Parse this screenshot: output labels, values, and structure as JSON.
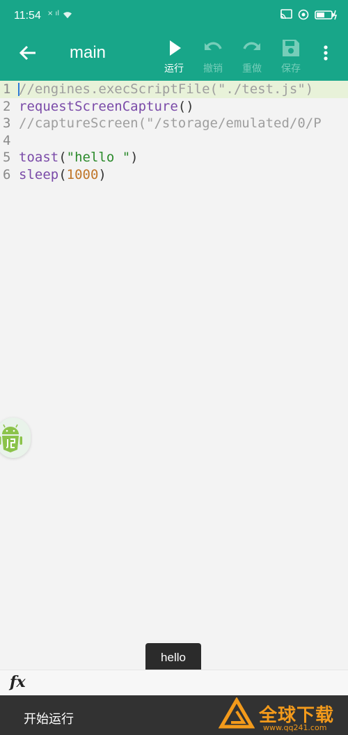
{
  "status_bar": {
    "time": "11:54",
    "signal_text": "× ıl"
  },
  "toolbar": {
    "title": "main",
    "actions": [
      {
        "label": "运行",
        "icon": "play-icon",
        "enabled": true
      },
      {
        "label": "撤销",
        "icon": "undo-icon",
        "enabled": false
      },
      {
        "label": "重做",
        "icon": "redo-icon",
        "enabled": false
      },
      {
        "label": "保存",
        "icon": "save-icon",
        "enabled": false
      }
    ]
  },
  "editor": {
    "active_line": 1,
    "lines": [
      {
        "no": "1",
        "text": "//engines.execScriptFile(\"./test.js\")"
      },
      {
        "no": "2",
        "text": "requestScreenCapture()"
      },
      {
        "no": "3",
        "text": "//captureScreen(\"/storage/emulated/0/P"
      },
      {
        "no": "4",
        "text": ""
      },
      {
        "no": "5",
        "text": "toast(\"hello \")"
      },
      {
        "no": "6",
        "text": "sleep(1000)"
      }
    ],
    "colors": {
      "comment": "#9e9e9e",
      "function": "#7a4aa8",
      "string": "#2b8a2b",
      "number": "#c0762a",
      "active_line_bg": "#e8f2d9"
    }
  },
  "toast": {
    "text": "hello"
  },
  "fx_bar": {
    "label": "fx"
  },
  "snackbar": {
    "text": "开始运行"
  },
  "watermark": {
    "text": "全球下载",
    "url": "www.qq241.com"
  },
  "colors": {
    "accent": "#18a689",
    "snackbar_bg": "#323232",
    "watermark": "#f39a1b"
  }
}
